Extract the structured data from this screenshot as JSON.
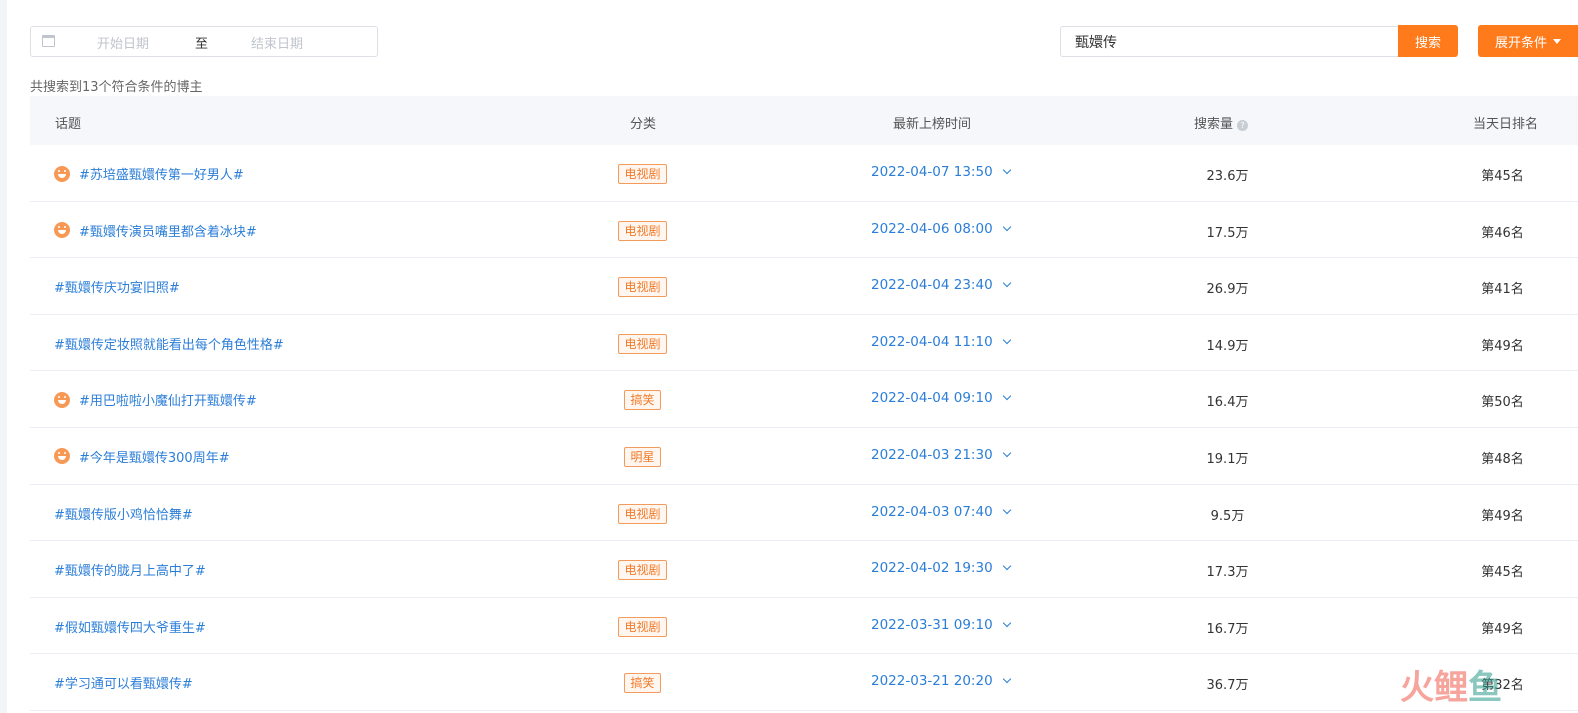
{
  "filters": {
    "date_start_placeholder": "开始日期",
    "date_separator": "至",
    "date_end_placeholder": "结束日期",
    "search_value": "甄嬛传",
    "search_button": "搜索",
    "expand_button": "展开条件"
  },
  "summary": "共搜索到13个符合条件的博主",
  "table": {
    "headers": {
      "topic": "话题",
      "category": "分类",
      "latest_time": "最新上榜时间",
      "search_volume": "搜索量",
      "daily_rank": "当天日排名"
    },
    "rows": [
      {
        "hot": true,
        "topic": "#苏培盛甄嬛传第一好男人#",
        "category": "电视剧",
        "time": "2022-04-07 13:50",
        "volume": "23.6万",
        "rank": "第45名"
      },
      {
        "hot": true,
        "topic": "#甄嬛传演员嘴里都含着冰块#",
        "category": "电视剧",
        "time": "2022-04-06 08:00",
        "volume": "17.5万",
        "rank": "第46名"
      },
      {
        "hot": false,
        "topic": "#甄嬛传庆功宴旧照#",
        "category": "电视剧",
        "time": "2022-04-04 23:40",
        "volume": "26.9万",
        "rank": "第41名"
      },
      {
        "hot": false,
        "topic": "#甄嬛传定妆照就能看出每个角色性格#",
        "category": "电视剧",
        "time": "2022-04-04 11:10",
        "volume": "14.9万",
        "rank": "第49名"
      },
      {
        "hot": true,
        "topic": "#用巴啦啦小魔仙打开甄嬛传#",
        "category": "搞笑",
        "time": "2022-04-04 09:10",
        "volume": "16.4万",
        "rank": "第50名"
      },
      {
        "hot": true,
        "topic": "#今年是甄嬛传300周年#",
        "category": "明星",
        "time": "2022-04-03 21:30",
        "volume": "19.1万",
        "rank": "第48名"
      },
      {
        "hot": false,
        "topic": "#甄嬛传版小鸡恰恰舞#",
        "category": "电视剧",
        "time": "2022-04-03 07:40",
        "volume": "9.5万",
        "rank": "第49名"
      },
      {
        "hot": false,
        "topic": "#甄嬛传的胧月上高中了#",
        "category": "电视剧",
        "time": "2022-04-02 19:30",
        "volume": "17.3万",
        "rank": "第45名"
      },
      {
        "hot": false,
        "topic": "#假如甄嬛传四大爷重生#",
        "category": "电视剧",
        "time": "2022-03-31 09:10",
        "volume": "16.7万",
        "rank": "第49名"
      },
      {
        "hot": false,
        "topic": "#学习通可以看甄嬛传#",
        "category": "搞笑",
        "time": "2022-03-21 20:20",
        "volume": "36.7万",
        "rank": "第32名"
      }
    ]
  },
  "watermark": {
    "chars": [
      "火",
      "鲤",
      "鱼"
    ]
  },
  "colors": {
    "accent": "#ff7a1a",
    "link": "#2b7ed8",
    "tag": "#f27a2a"
  }
}
